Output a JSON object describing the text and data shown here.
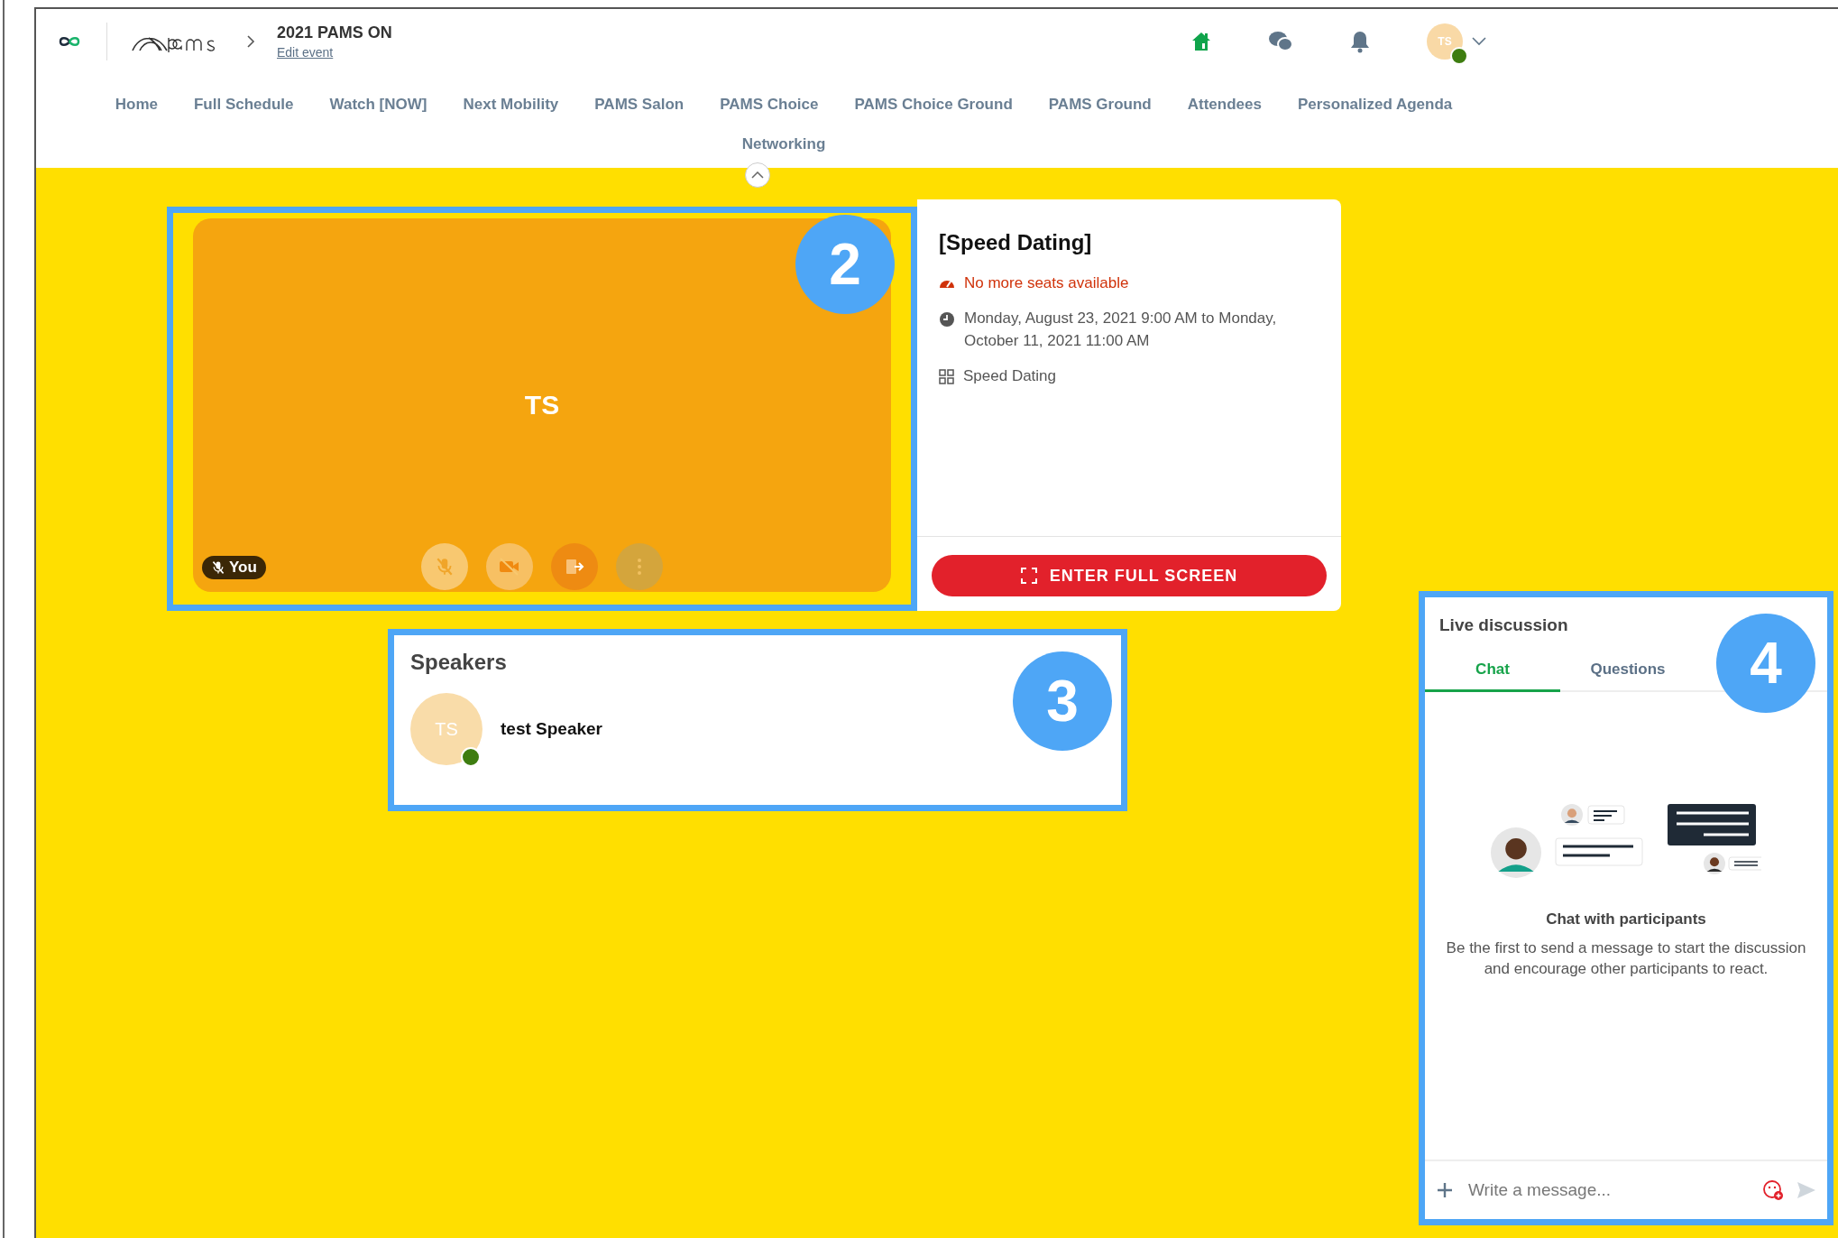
{
  "header": {
    "title": "2021 PAMS ON",
    "edit_link": "Edit event",
    "avatar": {
      "initials": "TS",
      "online": true
    }
  },
  "nav": [
    {
      "label": "Home"
    },
    {
      "label": "Full Schedule"
    },
    {
      "label": "Watch [NOW]"
    },
    {
      "label": "Next Mobility"
    },
    {
      "label": "PAMS Salon"
    },
    {
      "label": "PAMS Choice"
    },
    {
      "label": "PAMS Choice Ground"
    },
    {
      "label": "PAMS Ground"
    },
    {
      "label": "Attendees"
    },
    {
      "label": "Personalized Agenda"
    },
    {
      "label": "Networking"
    }
  ],
  "video": {
    "initials": "TS",
    "self_label": "You",
    "muted": true
  },
  "session": {
    "title": "[Speed Dating]",
    "availability": "No more seats available",
    "schedule": "Monday, August 23, 2021 9:00 AM to Monday, October 11, 2021 11:00 AM",
    "category": "Speed Dating",
    "fullscreen_button": "ENTER FULL SCREEN"
  },
  "speakers": {
    "title": "Speakers",
    "items": [
      {
        "initials": "TS",
        "name": "test Speaker",
        "online": true
      }
    ]
  },
  "live_discussion": {
    "title": "Live discussion",
    "tabs": [
      {
        "label": "Chat",
        "selected": true
      },
      {
        "label": "Questions",
        "selected": false
      }
    ],
    "empty_title": "Chat with participants",
    "empty_text": "Be the first to send a message to start the discussion and encourage other participants to react.",
    "input": {
      "placeholder": "Write a message..."
    }
  },
  "annotations": [
    {
      "label": "2"
    },
    {
      "label": "3"
    },
    {
      "label": "4"
    }
  ]
}
